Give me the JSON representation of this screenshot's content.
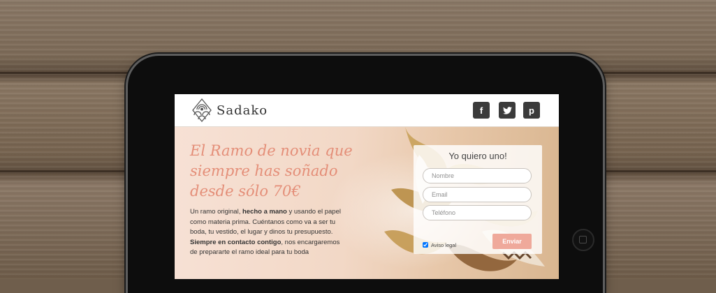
{
  "site": {
    "brand": "Sadako",
    "social": [
      {
        "icon": "facebook-icon",
        "glyph": "f"
      },
      {
        "icon": "twitter-icon",
        "glyph": "t"
      },
      {
        "icon": "pinterest-icon",
        "glyph": "p"
      }
    ]
  },
  "hero": {
    "headline_line1": "El Ramo de novia que",
    "headline_line2": "siempre has soñado",
    "headline_line3": "desde sólo 70€",
    "body_intro": "Un ramo original, ",
    "body_bold1": "hecho a mano",
    "body_mid": " y usando el papel como materia prima. Cuéntanos como va a ser tu boda, tu vestido, el lugar y dinos tu presupuesto. ",
    "body_bold2": "Siempre en contacto contigo",
    "body_end": ", nos encargaremos de prepararte el ramo ideal para tu boda"
  },
  "form": {
    "title": "Yo quiero uno!",
    "name_placeholder": "Nombre",
    "email_placeholder": "Email",
    "phone_placeholder": "Teléfono",
    "legal_label": "Aviso legal",
    "legal_checked": true,
    "submit_label": "Enviar"
  },
  "colors": {
    "accent_pink": "#e48e78",
    "button": "#efa99b",
    "social_bg": "#3b3b3b"
  }
}
